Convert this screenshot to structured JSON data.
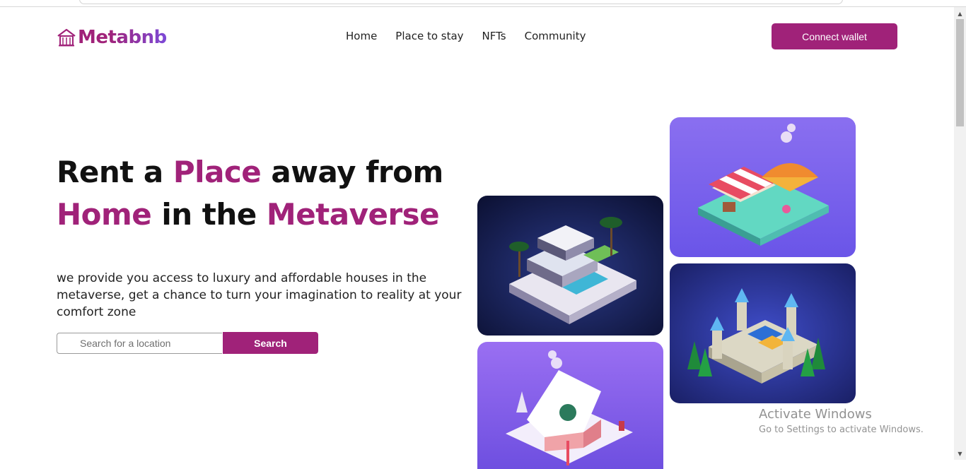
{
  "brand": {
    "name": "Metabnb",
    "icon": "house-icon",
    "color": "#A02279"
  },
  "nav": {
    "items": [
      "Home",
      "Place to stay",
      "NFTs",
      "Community"
    ]
  },
  "header": {
    "connect_label": "Connect wallet"
  },
  "hero": {
    "title_line1": {
      "a": "Rent a ",
      "b": "Place",
      "c": " away from"
    },
    "title_line2": {
      "a": "Home",
      "b": " in the ",
      "c": "Metaverse"
    },
    "description": "we provide you access to luxury and affordable houses in the metaverse, get a chance to turn your imagination to reality at your comfort zone"
  },
  "search": {
    "placeholder": "Search for a location",
    "value": "",
    "button_label": "Search"
  },
  "gallery": [
    "villa-image",
    "market-image",
    "castle-image",
    "winter-house-image"
  ],
  "watermark": {
    "line1": "Activate Windows",
    "line2": "Go to Settings to activate Windows."
  }
}
